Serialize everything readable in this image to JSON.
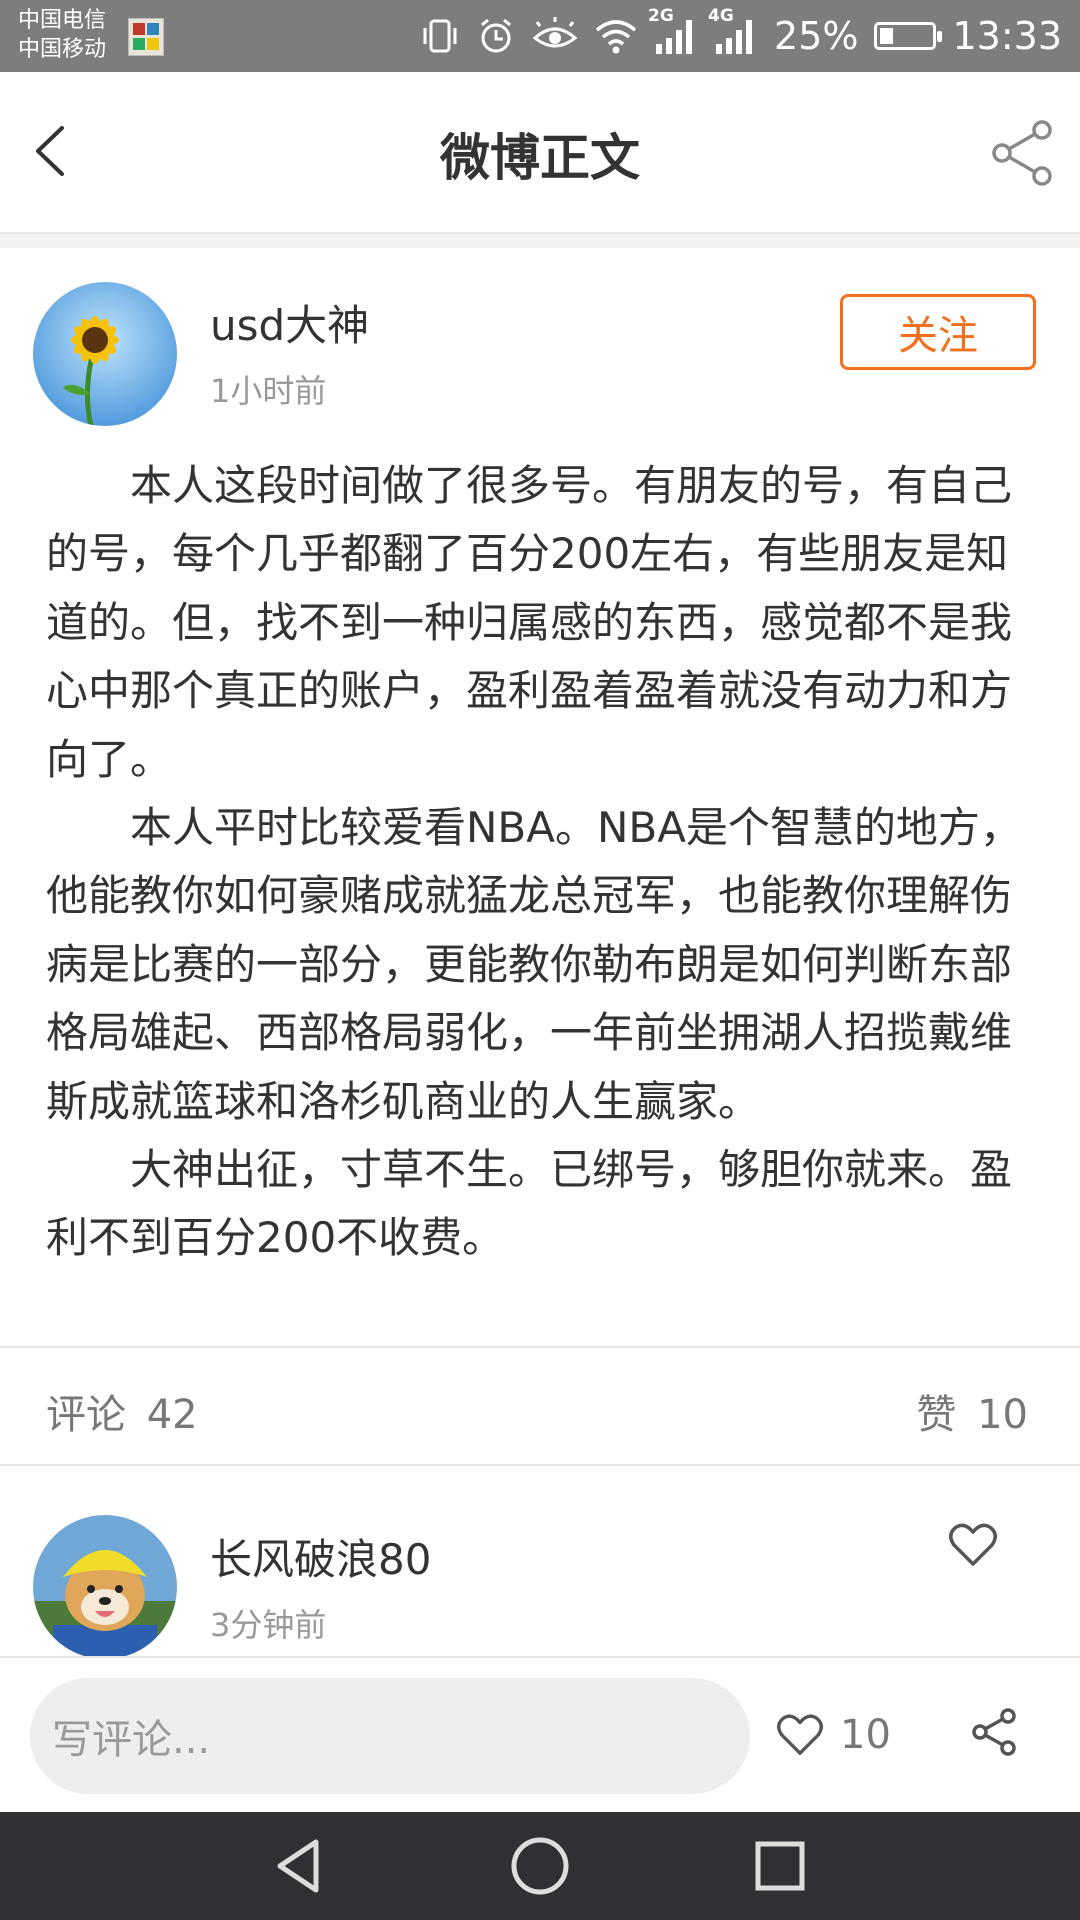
{
  "status_bar": {
    "carrier_1": "中国电信",
    "carrier_2": "中国移动",
    "network_1": "2G",
    "network_2": "4G",
    "battery": "25%",
    "battery_level": 0.25,
    "time": "13:33"
  },
  "header": {
    "title": "微博正文",
    "back_icon": "chevron-left-icon",
    "share_icon": "share-icon"
  },
  "post": {
    "author": "usd大神",
    "time": "1小时前",
    "follow_label": "关注",
    "paragraphs": [
      "本人这段时间做了很多号。有朋友的号，有自己的号，每个几乎都翻了百分200左右，有些朋友是知道的。但，找不到一种归属感的东西，感觉都不是我心中那个真正的账户，盈利盈着盈着就没有动力和方向了。",
      "本人平时比较爱看NBA。NBA是个智慧的地方，他能教你如何豪赌成就猛龙总冠军，也能教你理解伤病是比赛的一部分，更能教你勒布朗是如何判断东部格局雄起、西部格局弱化，一年前坐拥湖人招揽戴维斯成就篮球和洛杉矶商业的人生赢家。",
      "大神出征，寸草不生。已绑号，够胆你就来。盈利不到百分200不收费。"
    ]
  },
  "stats": {
    "comments_label": "评论",
    "comments_count": "42",
    "likes_label": "赞",
    "likes_count": "10"
  },
  "comment": {
    "author": "长风破浪80",
    "time": "3分钟前"
  },
  "bottom_bar": {
    "placeholder": "写评论...",
    "like_count": "10"
  },
  "colors": {
    "accent": "#f0701f",
    "status_bar": "#7d7d7d",
    "nav_bar": "#2f3033"
  }
}
